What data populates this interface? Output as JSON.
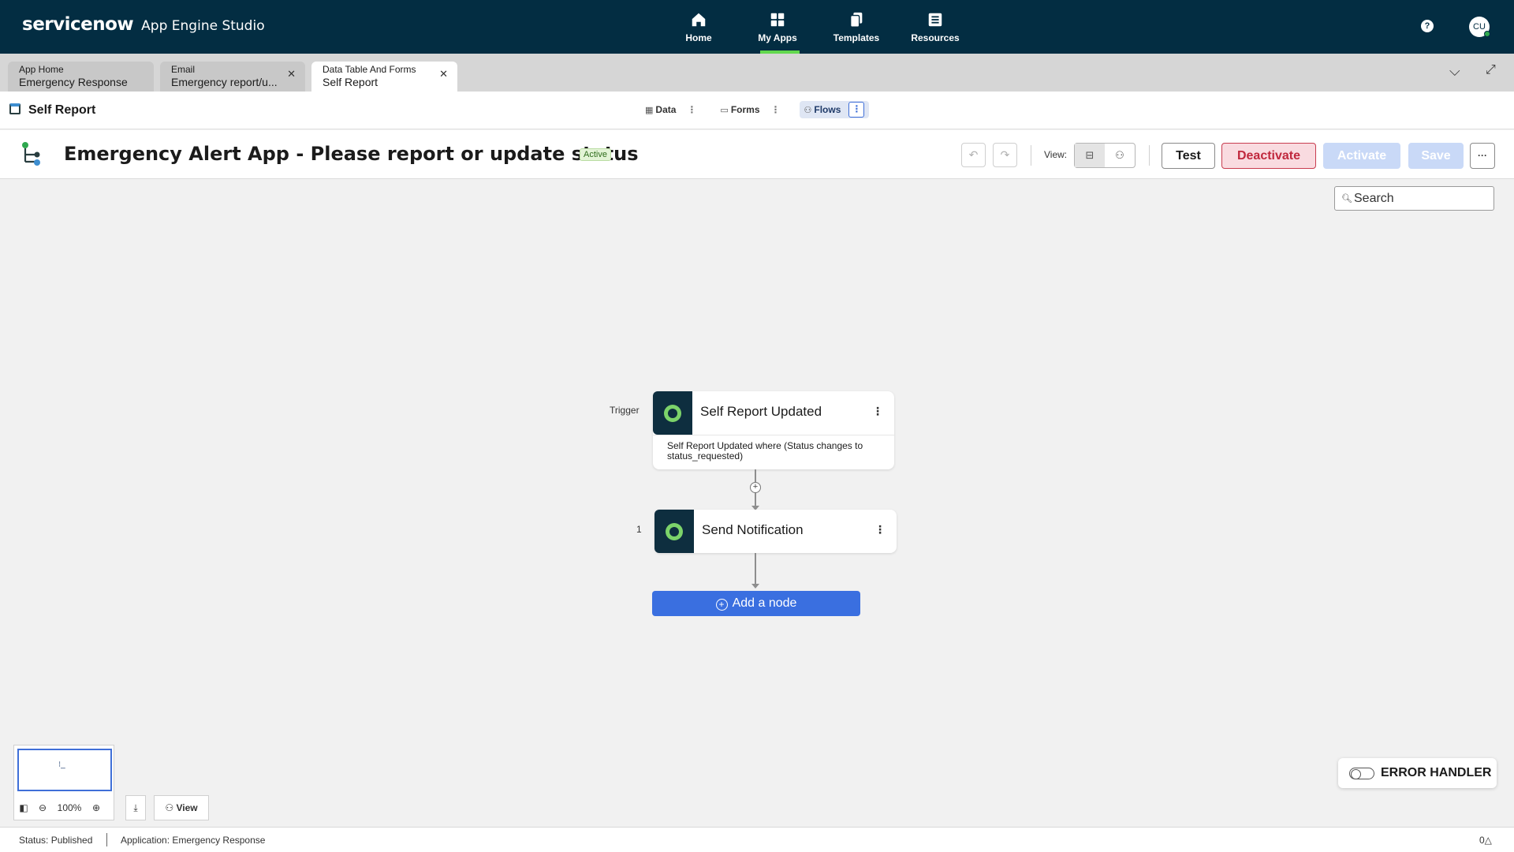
{
  "topnav": {
    "brand": "servicenow",
    "product": "App Engine Studio",
    "items": [
      {
        "label": "Home",
        "icon": "home-icon"
      },
      {
        "label": "My Apps",
        "icon": "grid-icon",
        "active": true
      },
      {
        "label": "Templates",
        "icon": "copy-icon"
      },
      {
        "label": "Resources",
        "icon": "book-icon"
      }
    ],
    "help_glyph": "?",
    "avatar_initials": "CU",
    "accent_color": "#62d84e"
  },
  "tabs": [
    {
      "kind": "App Home",
      "name": "Emergency Response"
    },
    {
      "kind": "Email",
      "name": "Emergency report/u..."
    },
    {
      "kind": "Data Table And Forms",
      "name": "Self Report"
    }
  ],
  "subheader": {
    "title": "Self Report",
    "tabs": [
      {
        "label": "Data"
      },
      {
        "label": "Forms"
      },
      {
        "label": "Flows",
        "active": true
      }
    ]
  },
  "flow": {
    "title": "Emergency Alert App - Please report or update status",
    "status": "Active",
    "view_label": "View:",
    "buttons": {
      "test": "Test",
      "deactivate": "Deactivate",
      "activate": "Activate",
      "save": "Save",
      "more": "···"
    }
  },
  "canvas": {
    "search_placeholder": "Search",
    "trigger_label": "Trigger",
    "trigger": {
      "title": "Self Report Updated",
      "description": "Self Report Updated where (Status  changes to status_requested)"
    },
    "step_number": "1",
    "action": {
      "title": "Send Notification"
    },
    "add_node_label": "Add a node",
    "zoom": "100%",
    "view_button": "View",
    "error_handler": "ERROR HANDLER"
  },
  "statusbar": {
    "status": "Status: Published",
    "application": "Application: Emergency Response",
    "notifications": "0△"
  }
}
